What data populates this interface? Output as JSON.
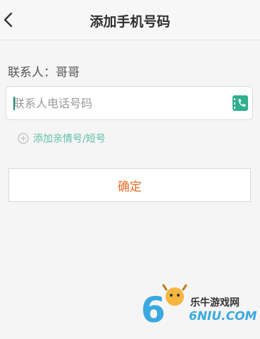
{
  "header": {
    "title": "添加手机号码",
    "back_icon": "chevron-left-icon"
  },
  "contact": {
    "label": "联系人：哥哥"
  },
  "phone": {
    "placeholder": "联系人电话号码",
    "value": "",
    "icon": "contact-book-icon"
  },
  "add_relative": {
    "label": "添加亲情号/短号",
    "icon": "plus-circle-icon"
  },
  "confirm": {
    "label": "确定"
  },
  "watermark": {
    "brand": "乐牛游戏网",
    "logo_text": "6NIU.COM"
  },
  "colors": {
    "accent": "#1aa58f",
    "confirm_text": "#f06a22",
    "link": "#5fbfa9"
  }
}
